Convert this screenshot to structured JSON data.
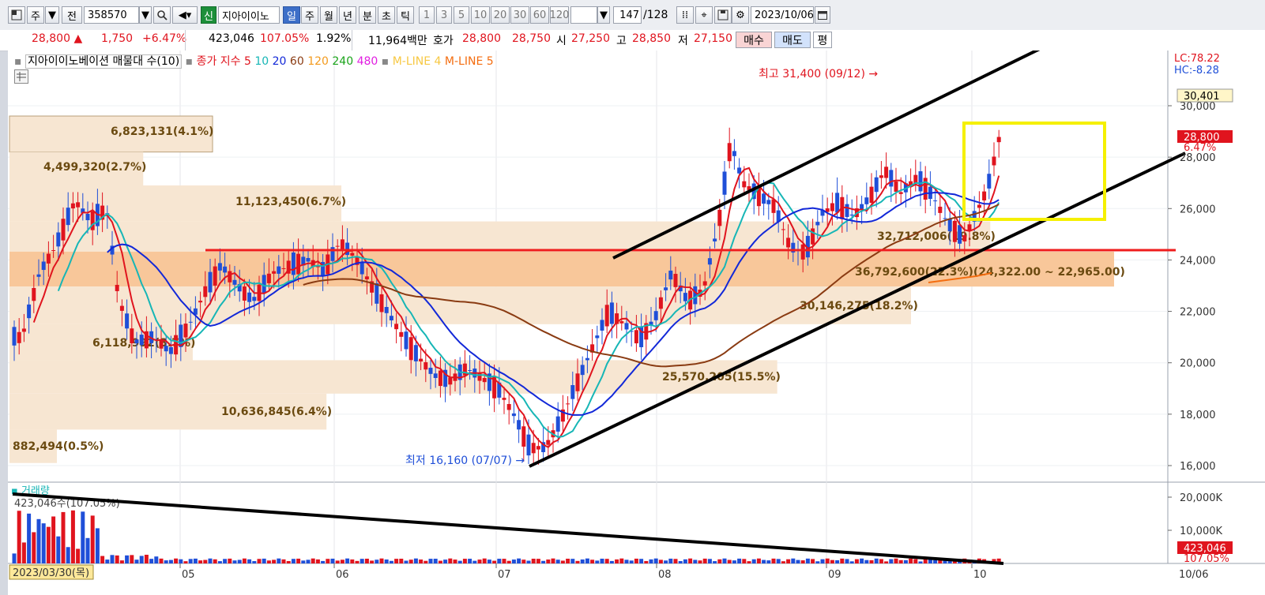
{
  "toolbar": {
    "type": "주",
    "prev": "전",
    "code": "358570",
    "new_badge": "신",
    "name": "지아이이노",
    "periods": [
      "일",
      "주",
      "월",
      "년",
      "분",
      "초",
      "틱"
    ],
    "minutes": [
      "1",
      "3",
      "5",
      "10",
      "20",
      "30",
      "60",
      "120"
    ],
    "count": "147",
    "total": "/128",
    "date": "2023/10/06"
  },
  "quote": {
    "price": "28,800",
    "change": "1,750",
    "rate": "+6.47%",
    "volume": "423,046",
    "vol_ratio": "107.05%",
    "turnover": "1.92%",
    "amount": "11,964백만",
    "bid_label": "호가",
    "bid1": "28,800",
    "bid2": "28,750",
    "open_label": "시",
    "open": "27,250",
    "high_label": "고",
    "high": "28,850",
    "low_label": "저",
    "low": "27,150",
    "buy": "매수",
    "sell": "매도",
    "avg": "평"
  },
  "legend": {
    "profile_title": "지아이이노베이션 매물대 수(10)",
    "ma_title": "종가 지수 5",
    "ma": [
      {
        "label": "10",
        "color": "#17b6b6"
      },
      {
        "label": "20",
        "color": "#1228d8"
      },
      {
        "label": "60",
        "color": "#8a3b12"
      },
      {
        "label": "120",
        "color": "#f39a1d"
      },
      {
        "label": "240",
        "color": "#19a319"
      },
      {
        "label": "480",
        "color": "#e11ee1"
      }
    ],
    "mline4": "M-LINE 4",
    "mline5": "M-LINE 5"
  },
  "right_axis": {
    "lc": "LC:78.22",
    "hc": "HC:-8.28",
    "ticks": [
      "30,000",
      "28,000",
      "26,000",
      "24,000",
      "22,000",
      "20,000",
      "18,000",
      "16,000"
    ],
    "box_top": "30,401",
    "box_price": "28,800",
    "box_rate": "6.47%"
  },
  "annotations": {
    "high": "최고 31,400 (09/12)",
    "low": "최저 16,160 (07/07)"
  },
  "volume_profile": [
    {
      "label": "6,823,131(4.1%)",
      "price_low": 28200,
      "price_high": 29600
    },
    {
      "label": "4,499,320(2.7%)",
      "price_low": 26900,
      "price_high": 28200
    },
    {
      "label": "11,123,450(6.7%)",
      "price_low": 25500,
      "price_high": 26900
    },
    {
      "label": "32,712,006(19.8%)",
      "price_low": 24100,
      "price_high": 25500
    },
    {
      "label": "36,792,600(22.3%)(24,322.00 ~ 22,965.00)",
      "price_low": 22965,
      "price_high": 24322
    },
    {
      "label": "30,146,275(18.2%)",
      "price_low": 21500,
      "price_high": 22965
    },
    {
      "label": "6,118,992(3.7%)",
      "price_low": 20100,
      "price_high": 21500
    },
    {
      "label": "25,570,205(15.5%)",
      "price_low": 18800,
      "price_high": 20100
    },
    {
      "label": "10,636,845(6.4%)",
      "price_low": 17400,
      "price_high": 18800
    },
    {
      "label": "882,494(0.5%)",
      "price_low": 16100,
      "price_high": 17400
    }
  ],
  "volume_panel": {
    "title": "거래량",
    "value": "423,046수(107.05%)",
    "ticks": [
      "20,000K",
      "10,000K"
    ],
    "box_value": "423,046",
    "box_rate": "107.05%"
  },
  "x_axis": {
    "current": "2023/03/30(목)",
    "months": [
      "05",
      "06",
      "07",
      "08",
      "09",
      "10"
    ],
    "end": "10/06"
  },
  "colors": {
    "up": "#e0141e",
    "down": "#1f4fd8",
    "profile": "#f7e6d2",
    "profile_max": "#f8c79a"
  }
}
